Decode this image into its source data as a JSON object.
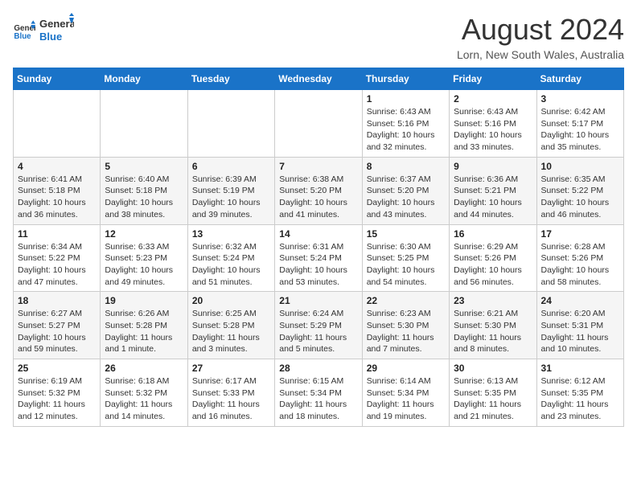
{
  "logo": {
    "line1": "General",
    "line2": "Blue"
  },
  "title": "August 2024",
  "location": "Lorn, New South Wales, Australia",
  "days_of_week": [
    "Sunday",
    "Monday",
    "Tuesday",
    "Wednesday",
    "Thursday",
    "Friday",
    "Saturday"
  ],
  "weeks": [
    [
      {
        "day": "",
        "info": ""
      },
      {
        "day": "",
        "info": ""
      },
      {
        "day": "",
        "info": ""
      },
      {
        "day": "",
        "info": ""
      },
      {
        "day": "1",
        "info": "Sunrise: 6:43 AM\nSunset: 5:16 PM\nDaylight: 10 hours\nand 32 minutes."
      },
      {
        "day": "2",
        "info": "Sunrise: 6:43 AM\nSunset: 5:16 PM\nDaylight: 10 hours\nand 33 minutes."
      },
      {
        "day": "3",
        "info": "Sunrise: 6:42 AM\nSunset: 5:17 PM\nDaylight: 10 hours\nand 35 minutes."
      }
    ],
    [
      {
        "day": "4",
        "info": "Sunrise: 6:41 AM\nSunset: 5:18 PM\nDaylight: 10 hours\nand 36 minutes."
      },
      {
        "day": "5",
        "info": "Sunrise: 6:40 AM\nSunset: 5:18 PM\nDaylight: 10 hours\nand 38 minutes."
      },
      {
        "day": "6",
        "info": "Sunrise: 6:39 AM\nSunset: 5:19 PM\nDaylight: 10 hours\nand 39 minutes."
      },
      {
        "day": "7",
        "info": "Sunrise: 6:38 AM\nSunset: 5:20 PM\nDaylight: 10 hours\nand 41 minutes."
      },
      {
        "day": "8",
        "info": "Sunrise: 6:37 AM\nSunset: 5:20 PM\nDaylight: 10 hours\nand 43 minutes."
      },
      {
        "day": "9",
        "info": "Sunrise: 6:36 AM\nSunset: 5:21 PM\nDaylight: 10 hours\nand 44 minutes."
      },
      {
        "day": "10",
        "info": "Sunrise: 6:35 AM\nSunset: 5:22 PM\nDaylight: 10 hours\nand 46 minutes."
      }
    ],
    [
      {
        "day": "11",
        "info": "Sunrise: 6:34 AM\nSunset: 5:22 PM\nDaylight: 10 hours\nand 47 minutes."
      },
      {
        "day": "12",
        "info": "Sunrise: 6:33 AM\nSunset: 5:23 PM\nDaylight: 10 hours\nand 49 minutes."
      },
      {
        "day": "13",
        "info": "Sunrise: 6:32 AM\nSunset: 5:24 PM\nDaylight: 10 hours\nand 51 minutes."
      },
      {
        "day": "14",
        "info": "Sunrise: 6:31 AM\nSunset: 5:24 PM\nDaylight: 10 hours\nand 53 minutes."
      },
      {
        "day": "15",
        "info": "Sunrise: 6:30 AM\nSunset: 5:25 PM\nDaylight: 10 hours\nand 54 minutes."
      },
      {
        "day": "16",
        "info": "Sunrise: 6:29 AM\nSunset: 5:26 PM\nDaylight: 10 hours\nand 56 minutes."
      },
      {
        "day": "17",
        "info": "Sunrise: 6:28 AM\nSunset: 5:26 PM\nDaylight: 10 hours\nand 58 minutes."
      }
    ],
    [
      {
        "day": "18",
        "info": "Sunrise: 6:27 AM\nSunset: 5:27 PM\nDaylight: 10 hours\nand 59 minutes."
      },
      {
        "day": "19",
        "info": "Sunrise: 6:26 AM\nSunset: 5:28 PM\nDaylight: 11 hours\nand 1 minute."
      },
      {
        "day": "20",
        "info": "Sunrise: 6:25 AM\nSunset: 5:28 PM\nDaylight: 11 hours\nand 3 minutes."
      },
      {
        "day": "21",
        "info": "Sunrise: 6:24 AM\nSunset: 5:29 PM\nDaylight: 11 hours\nand 5 minutes."
      },
      {
        "day": "22",
        "info": "Sunrise: 6:23 AM\nSunset: 5:30 PM\nDaylight: 11 hours\nand 7 minutes."
      },
      {
        "day": "23",
        "info": "Sunrise: 6:21 AM\nSunset: 5:30 PM\nDaylight: 11 hours\nand 8 minutes."
      },
      {
        "day": "24",
        "info": "Sunrise: 6:20 AM\nSunset: 5:31 PM\nDaylight: 11 hours\nand 10 minutes."
      }
    ],
    [
      {
        "day": "25",
        "info": "Sunrise: 6:19 AM\nSunset: 5:32 PM\nDaylight: 11 hours\nand 12 minutes."
      },
      {
        "day": "26",
        "info": "Sunrise: 6:18 AM\nSunset: 5:32 PM\nDaylight: 11 hours\nand 14 minutes."
      },
      {
        "day": "27",
        "info": "Sunrise: 6:17 AM\nSunset: 5:33 PM\nDaylight: 11 hours\nand 16 minutes."
      },
      {
        "day": "28",
        "info": "Sunrise: 6:15 AM\nSunset: 5:34 PM\nDaylight: 11 hours\nand 18 minutes."
      },
      {
        "day": "29",
        "info": "Sunrise: 6:14 AM\nSunset: 5:34 PM\nDaylight: 11 hours\nand 19 minutes."
      },
      {
        "day": "30",
        "info": "Sunrise: 6:13 AM\nSunset: 5:35 PM\nDaylight: 11 hours\nand 21 minutes."
      },
      {
        "day": "31",
        "info": "Sunrise: 6:12 AM\nSunset: 5:35 PM\nDaylight: 11 hours\nand 23 minutes."
      }
    ]
  ]
}
